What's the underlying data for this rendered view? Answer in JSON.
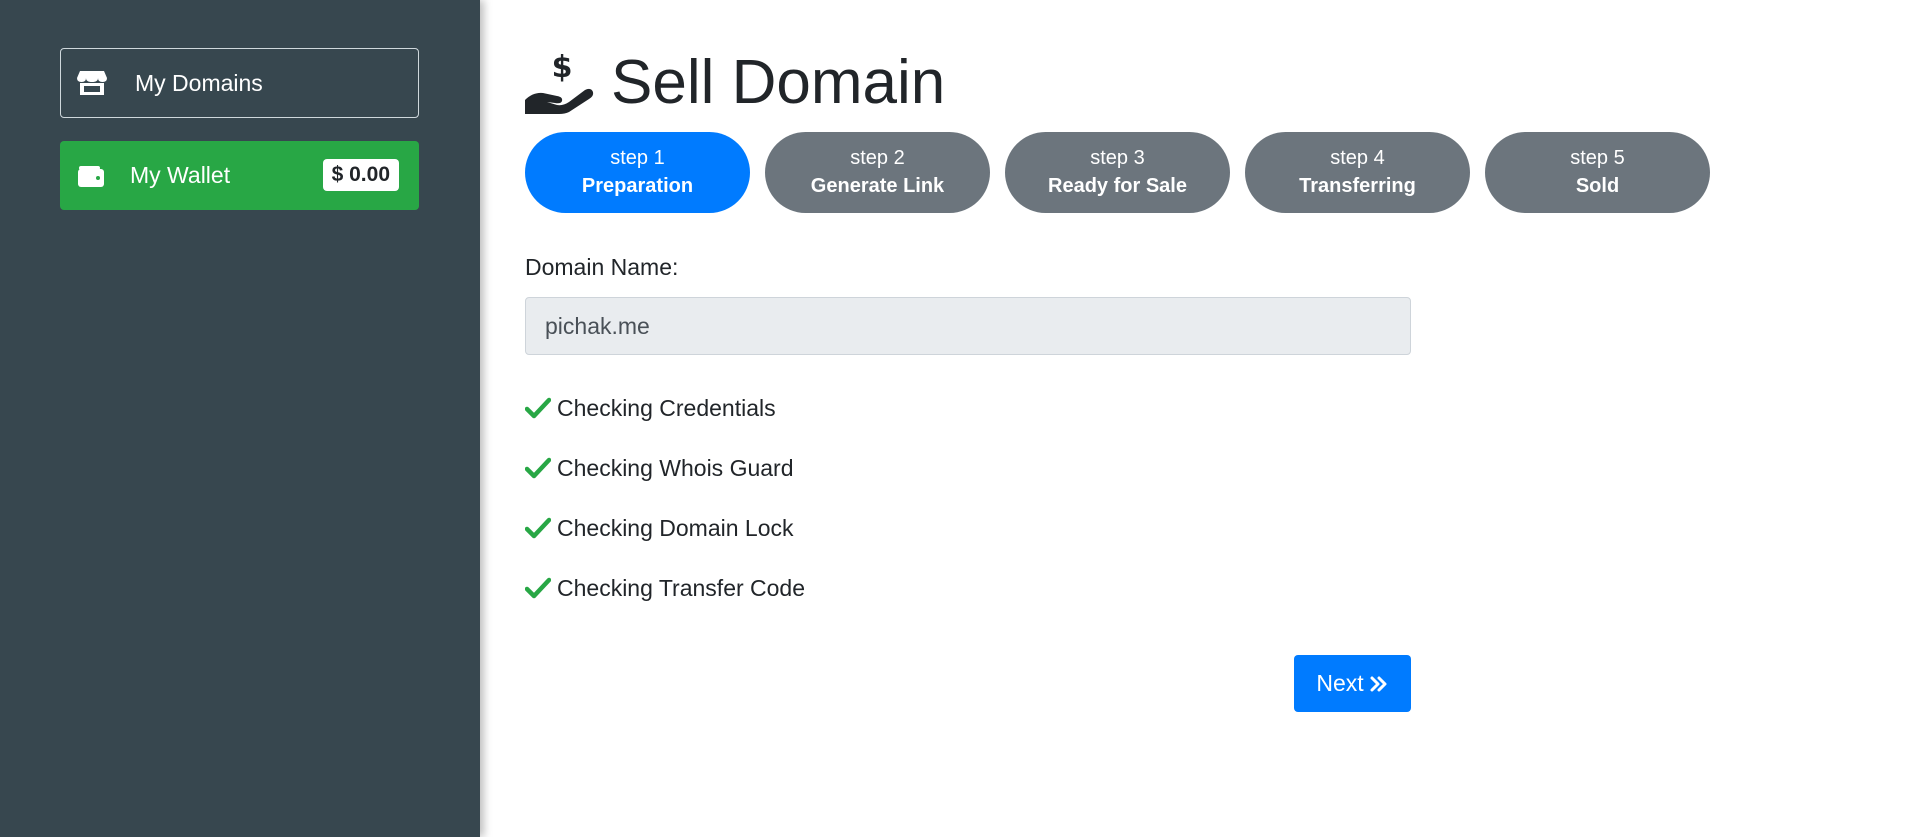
{
  "sidebar": {
    "my_domains": {
      "label": "My Domains",
      "icon": "store-icon"
    },
    "my_wallet": {
      "label": "My Wallet",
      "icon": "wallet-icon",
      "balance": "$ 0.00"
    }
  },
  "main": {
    "title": "Sell Domain",
    "title_icon": "hand-holding-dollar-icon",
    "steps": [
      {
        "num": "step 1",
        "name": "Preparation",
        "active": true
      },
      {
        "num": "step 2",
        "name": "Generate Link",
        "active": false
      },
      {
        "num": "step 3",
        "name": "Ready for Sale",
        "active": false
      },
      {
        "num": "step 4",
        "name": "Transferring",
        "active": false
      },
      {
        "num": "step 5",
        "name": "Sold",
        "active": false
      }
    ],
    "domain_label": "Domain Name:",
    "domain_value": "pichak.me",
    "checks": [
      "Checking Credentials",
      "Checking Whois Guard",
      "Checking Domain Lock",
      "Checking Transfer Code"
    ],
    "next_label": "Next"
  },
  "colors": {
    "sidebar_bg": "#37474f",
    "wallet_green": "#28a745",
    "primary": "#007bff",
    "step_inactive": "#6c757d",
    "check_green": "#28a745"
  }
}
